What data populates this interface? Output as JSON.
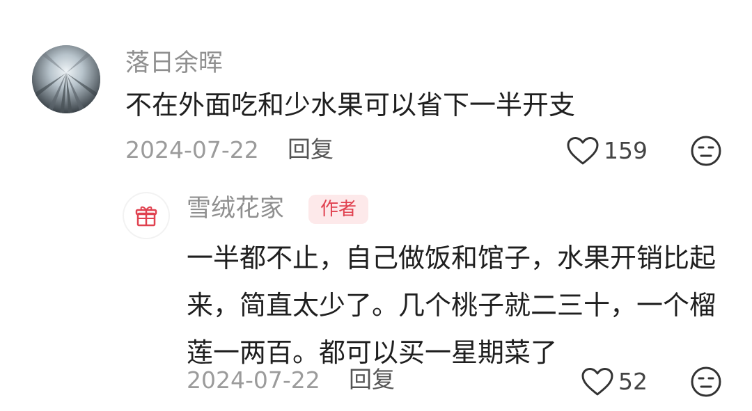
{
  "comments": [
    {
      "username": "落日余晖",
      "text": "不在外面吃和少水果可以省下一半开支",
      "date": "2024-07-22",
      "reply_label": "回复",
      "likes": "159",
      "reply": {
        "username": "雪绒花家",
        "badge": "作者",
        "text": "一半都不止，自己做饭和馆子，水果开销比起来，简直太少了。几个桃子就二三十，一个榴莲一两百。都可以买一星期菜了",
        "date": "2024-07-22",
        "reply_label": "回复",
        "likes": "52"
      }
    }
  ],
  "icons": {
    "avatar_main": "tree-canopy-photo-avatar",
    "avatar_reply": "gift-icon",
    "like": "heart-outline-icon",
    "dislike": "neutral-face-icon"
  },
  "colors": {
    "badge_text": "#e0414f",
    "badge_bg": "#fde9ea",
    "gift": "#e0414f"
  }
}
